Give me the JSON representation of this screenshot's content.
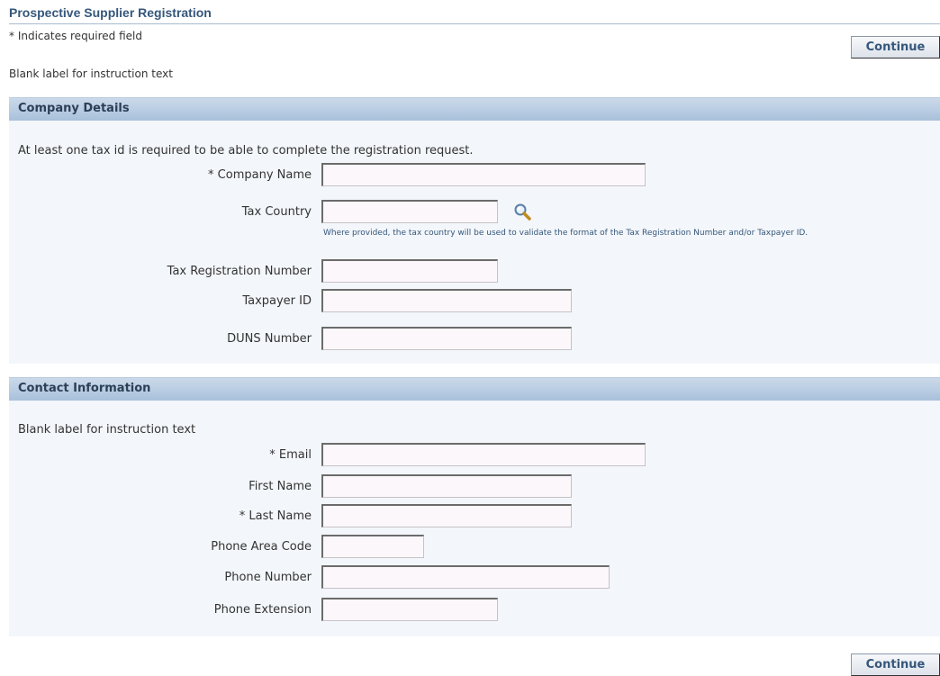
{
  "page": {
    "title": "Prospective Supplier Registration",
    "required_hint": "* Indicates required field",
    "instruction": "Blank label for instruction text"
  },
  "buttons": {
    "continue_label": "Continue"
  },
  "company": {
    "header": "Company Details",
    "note": "At least one tax id is required to be able to complete the registration request.",
    "fields": {
      "company_name": {
        "label": "* Company Name",
        "value": ""
      },
      "tax_country": {
        "label": "Tax Country",
        "value": ""
      },
      "tax_country_tip": "Where provided, the tax country will be used to validate the format of the Tax Registration Number and/or Taxpayer ID.",
      "tax_registration_number": {
        "label": "Tax Registration Number",
        "value": ""
      },
      "taxpayer_id": {
        "label": "Taxpayer ID",
        "value": ""
      },
      "duns_number": {
        "label": "DUNS Number",
        "value": ""
      }
    }
  },
  "contact": {
    "header": "Contact Information",
    "note": "Blank label for instruction text",
    "fields": {
      "email": {
        "label": "* Email",
        "value": ""
      },
      "first_name": {
        "label": "First Name",
        "value": ""
      },
      "last_name": {
        "label": "* Last Name",
        "value": ""
      },
      "phone_area_code": {
        "label": "Phone Area Code",
        "value": ""
      },
      "phone_number": {
        "label": "Phone Number",
        "value": ""
      },
      "phone_extension": {
        "label": "Phone Extension",
        "value": ""
      }
    }
  },
  "icons": {
    "lookup": "search-icon"
  },
  "colors": {
    "title": "#35577b",
    "section_header": "#a9c1db",
    "section_body": "#f3f6fa",
    "input_background": "#fcf7fb"
  }
}
